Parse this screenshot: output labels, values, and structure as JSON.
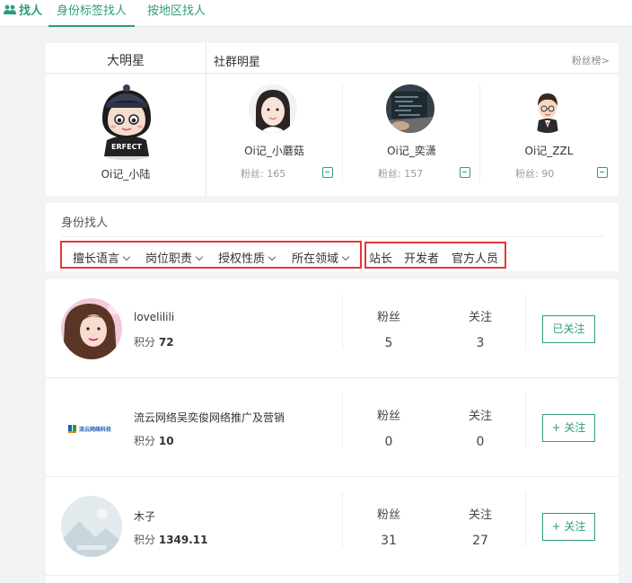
{
  "nav": {
    "tabs": [
      {
        "label": "找人",
        "icon": "users-icon"
      },
      {
        "label": "身份标签找人"
      },
      {
        "label": "按地区找人"
      }
    ]
  },
  "stars": {
    "big_star_title": "大明星",
    "group_star_title": "社群明星",
    "fans_rank_link": "粉丝榜>",
    "big_star": {
      "name": "Oi记_小陆"
    },
    "group_stars": [
      {
        "name": "Oi记_小蘑菇",
        "fans": "粉丝: 165"
      },
      {
        "name": "Oi记_奕潇",
        "fans": "粉丝: 157"
      },
      {
        "name": "Oi记_ZZL",
        "fans": "粉丝: 90"
      }
    ]
  },
  "filter": {
    "title": "身份找人",
    "dropdowns": [
      "擅长语言",
      "岗位职责",
      "授权性质",
      "所在领域"
    ],
    "roles": [
      "站长",
      "开发者",
      "官方人员"
    ]
  },
  "list": {
    "fans_label": "粉丝",
    "follow_label": "关注",
    "rows": [
      {
        "name": "lovelilili",
        "score_label": "积分",
        "score": "72",
        "fans": "5",
        "follows": "3",
        "button": "已关注"
      },
      {
        "name": "流云网络吴奕俊网络推广及营销",
        "score_label": "积分",
        "score": "10",
        "fans": "0",
        "follows": "0",
        "button": "+ 关注"
      },
      {
        "name": "木子",
        "score_label": "积分",
        "score": "1349.11",
        "fans": "31",
        "follows": "27",
        "button": "+ 关注"
      }
    ]
  },
  "colors": {
    "accent": "#2e9b7f",
    "highlight": "#e53935"
  }
}
